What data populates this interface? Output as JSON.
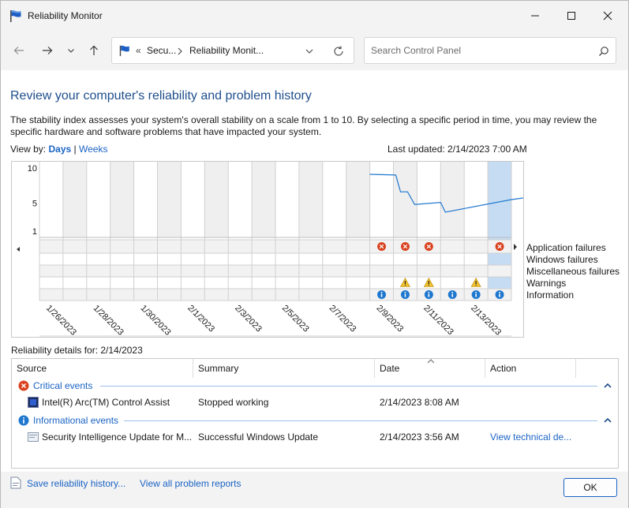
{
  "window": {
    "title": "Reliability Monitor"
  },
  "address": {
    "prefix": "«",
    "segments": [
      "Secu...",
      "Reliability Monit..."
    ]
  },
  "search": {
    "placeholder": "Search Control Panel"
  },
  "heading": "Review your computer's reliability and problem history",
  "description": "The stability index assesses your system's overall stability on a scale from 1 to 10. By selecting a specific period in time, you may review the specific hardware and software problems that have impacted your system.",
  "viewby": {
    "label": "View by:",
    "days": "Days",
    "sep": "|",
    "weeks": "Weeks"
  },
  "last_updated": "Last updated: 2/14/2023 7:00 AM",
  "chart_data": {
    "type": "line",
    "yticks": [
      "10",
      "5",
      "1"
    ],
    "ylim": [
      1,
      10
    ],
    "dates": [
      "1/26/2023",
      "1/28/2023",
      "1/30/2023",
      "2/1/2023",
      "2/3/2023",
      "2/5/2023",
      "2/7/2023",
      "2/9/2023",
      "2/11/2023",
      "2/13/2023"
    ],
    "stability": [
      {
        "x": 14.0,
        "y": 9.1
      },
      {
        "x": 15.1,
        "y": 9.0
      },
      {
        "x": 15.3,
        "y": 6.6
      },
      {
        "x": 15.6,
        "y": 6.6
      },
      {
        "x": 15.9,
        "y": 4.8
      },
      {
        "x": 17.0,
        "y": 5.1
      },
      {
        "x": 17.2,
        "y": 3.7
      },
      {
        "x": 20.0,
        "y": 5.5
      },
      {
        "x": 20.9,
        "y": 5.9
      }
    ],
    "selected_column": 19,
    "rows": [
      "Application failures",
      "Windows failures",
      "Miscellaneous failures",
      "Warnings",
      "Information"
    ],
    "events": {
      "app_failures": [
        14,
        15,
        16,
        19
      ],
      "warnings": [
        15,
        16,
        18
      ],
      "information": [
        14,
        15,
        16,
        17,
        18,
        19
      ]
    }
  },
  "details": {
    "label": "Reliability details for: 2/14/2023",
    "columns": [
      "Source",
      "Summary",
      "Date",
      "Action"
    ],
    "groups": [
      {
        "title": "Critical events",
        "rows": [
          {
            "source": "Intel(R) Arc(TM) Control Assist",
            "summary": "Stopped working",
            "date": "2/14/2023 8:08 AM",
            "action": ""
          }
        ]
      },
      {
        "title": "Informational events",
        "rows": [
          {
            "source": "Security Intelligence Update for M...",
            "summary": "Successful Windows Update",
            "date": "2/14/2023 3:56 AM",
            "action": "View technical de..."
          }
        ]
      }
    ]
  },
  "footer": {
    "save": "Save reliability history...",
    "view_all": "View all problem reports",
    "ok": "OK"
  },
  "colors": {
    "accent": "#1a63c4",
    "error": "#d9421f",
    "warning": "#f2c12e",
    "info": "#1f78cf",
    "line": "#1f78cf",
    "selected": "#c5dcf3"
  }
}
